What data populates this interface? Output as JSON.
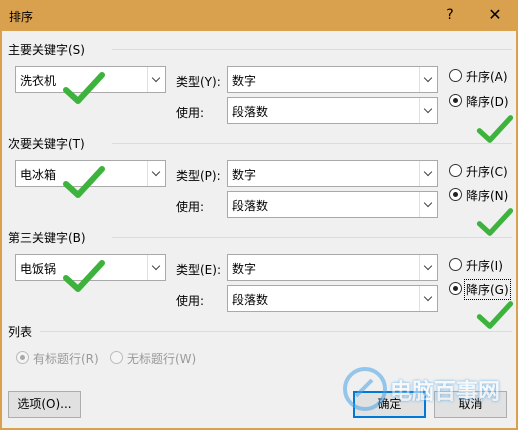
{
  "window": {
    "title": "排序",
    "help": "?",
    "close": "✕"
  },
  "keys": [
    {
      "heading": "主要关键字(S)",
      "column": "洗衣机",
      "type_label": "类型(Y):",
      "type_value": "数字",
      "use_label": "使用:",
      "use_value": "段落数",
      "asc_label": "升序(A)",
      "desc_label": "降序(D)",
      "selected": "desc"
    },
    {
      "heading": "次要关键字(T)",
      "column": "电冰箱",
      "type_label": "类型(P):",
      "type_value": "数字",
      "use_label": "使用:",
      "use_value": "段落数",
      "asc_label": "升序(C)",
      "desc_label": "降序(N)",
      "selected": "desc"
    },
    {
      "heading": "第三关键字(B)",
      "column": "电饭锅",
      "type_label": "类型(E):",
      "type_value": "数字",
      "use_label": "使用:",
      "use_value": "段落数",
      "asc_label": "升序(I)",
      "desc_label": "降序(G)",
      "selected": "desc"
    }
  ],
  "list": {
    "heading": "列表",
    "has_header": "有标题行(R)",
    "no_header": "无标题行(W)",
    "selected": "has_header",
    "enabled": false
  },
  "buttons": {
    "options": "选项(O)...",
    "ok": "确定",
    "cancel": "取消"
  },
  "watermark": {
    "text": "电脑百事网"
  },
  "colors": {
    "accent": "#0078d7",
    "titlebar": "#d9a04d",
    "check": "#3db33d"
  }
}
